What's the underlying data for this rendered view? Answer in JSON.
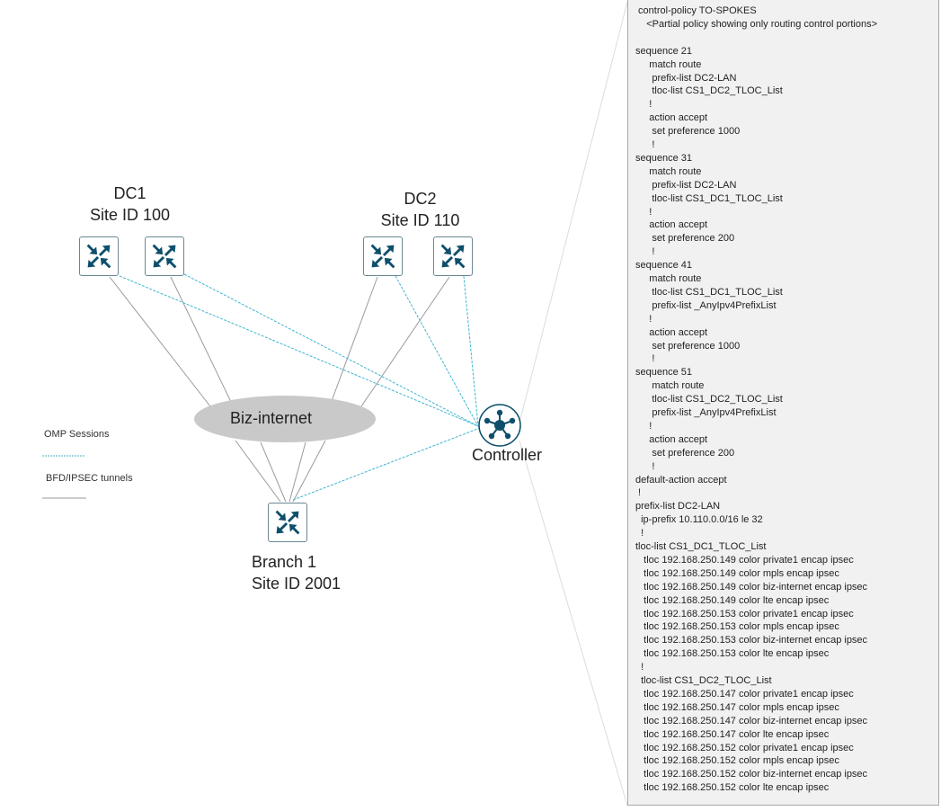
{
  "sites": {
    "dc1": {
      "name": "DC1",
      "site_id": "Site ID 100"
    },
    "dc2": {
      "name": "DC2",
      "site_id": "Site ID 110"
    },
    "branch1": {
      "name": "Branch 1",
      "site_id": "Site ID 2001"
    }
  },
  "cloud": {
    "label": "Biz-internet"
  },
  "controller": {
    "label": "Controller"
  },
  "legend": {
    "omp": "OMP Sessions",
    "bfd": "BFD/IPSEC tunnels"
  },
  "colors": {
    "router_icon": "#0d4f6b",
    "omp_line": "#3fb6d1",
    "tunnel_line": "#9a9a9a",
    "cloud_fill": "#c9c9c9",
    "panel_bg": "#f1f1f1"
  },
  "policy": {
    "lines": [
      " control-policy TO-SPOKES",
      "    <Partial policy showing only routing control portions>",
      "",
      "sequence 21",
      "     match route",
      "      prefix-list DC2-LAN",
      "      tloc-list CS1_DC2_TLOC_List",
      "     !",
      "     action accept",
      "      set preference 1000",
      "      !",
      "sequence 31",
      "     match route",
      "      prefix-list DC2-LAN",
      "      tloc-list CS1_DC1_TLOC_List",
      "     !",
      "     action accept",
      "      set preference 200",
      "      !",
      "sequence 41",
      "     match route",
      "      tloc-list CS1_DC1_TLOC_List",
      "      prefix-list _AnyIpv4PrefixList",
      "     !",
      "     action accept",
      "      set preference 1000",
      "      !",
      "sequence 51",
      "      match route",
      "      tloc-list CS1_DC2_TLOC_List",
      "      prefix-list _AnyIpv4PrefixList",
      "     !",
      "     action accept",
      "      set preference 200",
      "      !",
      "default-action accept",
      " !",
      "prefix-list DC2-LAN",
      "  ip-prefix 10.110.0.0/16 le 32",
      "  !",
      "tloc-list CS1_DC1_TLOC_List",
      "   tloc 192.168.250.149 color private1 encap ipsec",
      "   tloc 192.168.250.149 color mpls encap ipsec",
      "   tloc 192.168.250.149 color biz-internet encap ipsec",
      "   tloc 192.168.250.149 color lte encap ipsec",
      "   tloc 192.168.250.153 color private1 encap ipsec",
      "   tloc 192.168.250.153 color mpls encap ipsec",
      "   tloc 192.168.250.153 color biz-internet encap ipsec",
      "   tloc 192.168.250.153 color lte encap ipsec",
      "  !",
      "  tloc-list CS1_DC2_TLOC_List",
      "   tloc 192.168.250.147 color private1 encap ipsec",
      "   tloc 192.168.250.147 color mpls encap ipsec",
      "   tloc 192.168.250.147 color biz-internet encap ipsec",
      "   tloc 192.168.250.147 color lte encap ipsec",
      "   tloc 192.168.250.152 color private1 encap ipsec",
      "   tloc 192.168.250.152 color mpls encap ipsec",
      "   tloc 192.168.250.152 color biz-internet encap ipsec",
      "   tloc 192.168.250.152 color lte encap ipsec"
    ]
  }
}
